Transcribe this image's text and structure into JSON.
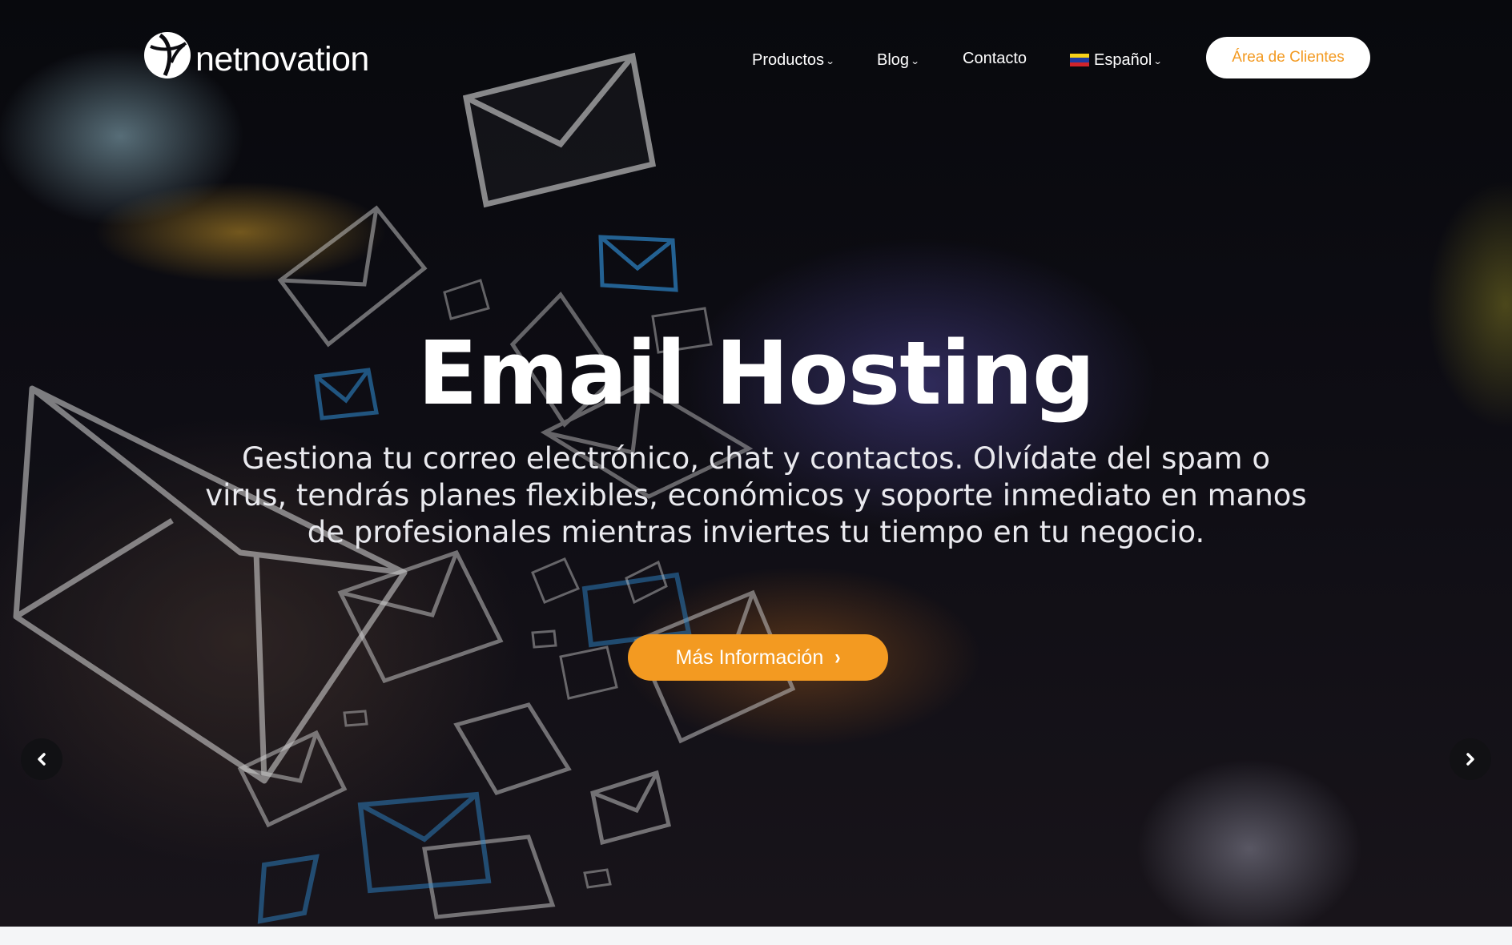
{
  "brand": {
    "name": "netnovation",
    "logo_icon": "netnovation-globe-logo"
  },
  "nav": {
    "items": [
      {
        "label": "Productos",
        "has_dropdown": true
      },
      {
        "label": "Blog",
        "has_dropdown": true
      },
      {
        "label": "Contacto",
        "has_dropdown": false
      }
    ],
    "language": {
      "label": "Español",
      "flag_icon": "venezuela-flag-icon",
      "has_dropdown": true
    },
    "client_area_label": "Área de Clientes"
  },
  "hero": {
    "title": "Email Hosting",
    "subtitle": "Gestiona tu correo electrónico, chat y contactos. Olvídate del spam o virus, tendrás planes flexibles, económicos y soporte inmediato en manos de profesionales mientras inviertes tu tiempo en tu negocio.",
    "cta_label": "Más Información",
    "cta_icon": "chevron-right-icon",
    "background_motif": "flying-envelope-icons"
  },
  "slider": {
    "prev_icon": "chevron-left-icon",
    "next_icon": "chevron-right-icon"
  },
  "colors": {
    "accent": "#f39a21",
    "hero_bg": "#0b0b10",
    "text_light": "#ffffff"
  }
}
